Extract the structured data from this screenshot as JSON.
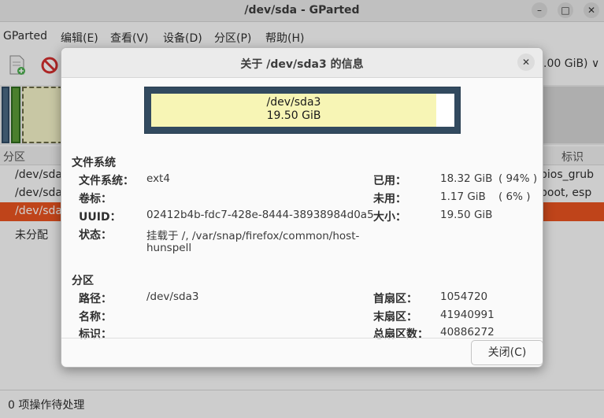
{
  "window": {
    "title": "/dev/sda - GParted",
    "minimize_glyph": "–",
    "maximize_glyph": "□",
    "close_glyph": "✕"
  },
  "menu": [
    "GParted",
    "编辑(E)",
    "查看(V)",
    "设备(D)",
    "分区(P)",
    "帮助(H)"
  ],
  "toolbar": {
    "icons": [
      "new-partition-icon",
      "delete-partition-icon"
    ],
    "device_selector": ".00 GiB) ∨"
  },
  "partition_list": {
    "header_partition": "分区",
    "header_flags": "标识",
    "rows": [
      {
        "name": "/dev/sda",
        "flags": "bios_grub"
      },
      {
        "name": "/dev/sda",
        "flags": "boot, esp"
      },
      {
        "name": "/dev/sda",
        "flags": ""
      },
      {
        "name": "未分配",
        "flags": ""
      }
    ]
  },
  "status_bar": "0 项操作待处理",
  "colors": {
    "accent": "#e95420",
    "partition_used": "#f7f5b5",
    "partition_border": "#324a5f"
  },
  "dialog": {
    "title": "关于 /dev/sda3 的信息",
    "close_glyph": "✕",
    "graphic": {
      "name": "/dev/sda3",
      "size": "19.50 GiB",
      "used_fraction": 0.94
    },
    "filesystem_section": {
      "title": "文件系统",
      "filesystem_label": "文件系统：",
      "filesystem_value": "ext4",
      "volume_label": "卷标：",
      "volume_value": "",
      "uuid_label": "UUID：",
      "uuid_value": "02412b4b-fdc7-428e-8444-38938984d0a5",
      "status_label": "状态：",
      "status_value_line1": "挂载于 /, /var/snap/firefox/common/host-",
      "status_value_line2": "hunspell",
      "used_label": "已用：",
      "used_value": "18.32 GiB",
      "used_pct": "( 94% )",
      "unused_label": "未用：",
      "unused_value": "1.17 GiB",
      "unused_pct": "( 6% )",
      "size_label": "大小：",
      "size_value": "19.50 GiB"
    },
    "partition_section": {
      "title": "分区",
      "path_label": "路径：",
      "path_value": "/dev/sda3",
      "name_label": "名称：",
      "name_value": "",
      "flags_label": "标识：",
      "flags_value": "",
      "first_sector_label": "首扇区：",
      "first_sector_value": "1054720",
      "last_sector_label": "末扇区：",
      "last_sector_value": "41940991",
      "total_sectors_label": "总扇区数：",
      "total_sectors_value": "40886272"
    },
    "close_button": "关闭(C)"
  }
}
